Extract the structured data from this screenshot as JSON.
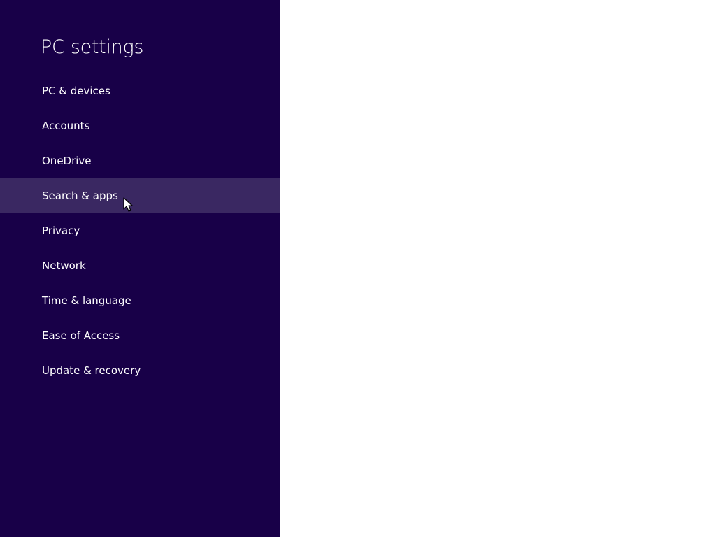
{
  "window": {
    "title": "PC settings"
  },
  "sidebar": {
    "items": [
      {
        "label": "PC & devices"
      },
      {
        "label": "Accounts"
      },
      {
        "label": "OneDrive"
      },
      {
        "label": "Search & apps"
      },
      {
        "label": "Privacy"
      },
      {
        "label": "Network"
      },
      {
        "label": "Time & language"
      },
      {
        "label": "Ease of Access"
      },
      {
        "label": "Update & recovery"
      }
    ],
    "active_item": "Search & apps"
  },
  "colors": {
    "sidebar_background": "#180048",
    "active_item_background": "#3a2862",
    "content_background": "#ffffff",
    "text": "#ffffff"
  },
  "icons": {
    "cursor": "mouse-pointer-icon"
  }
}
